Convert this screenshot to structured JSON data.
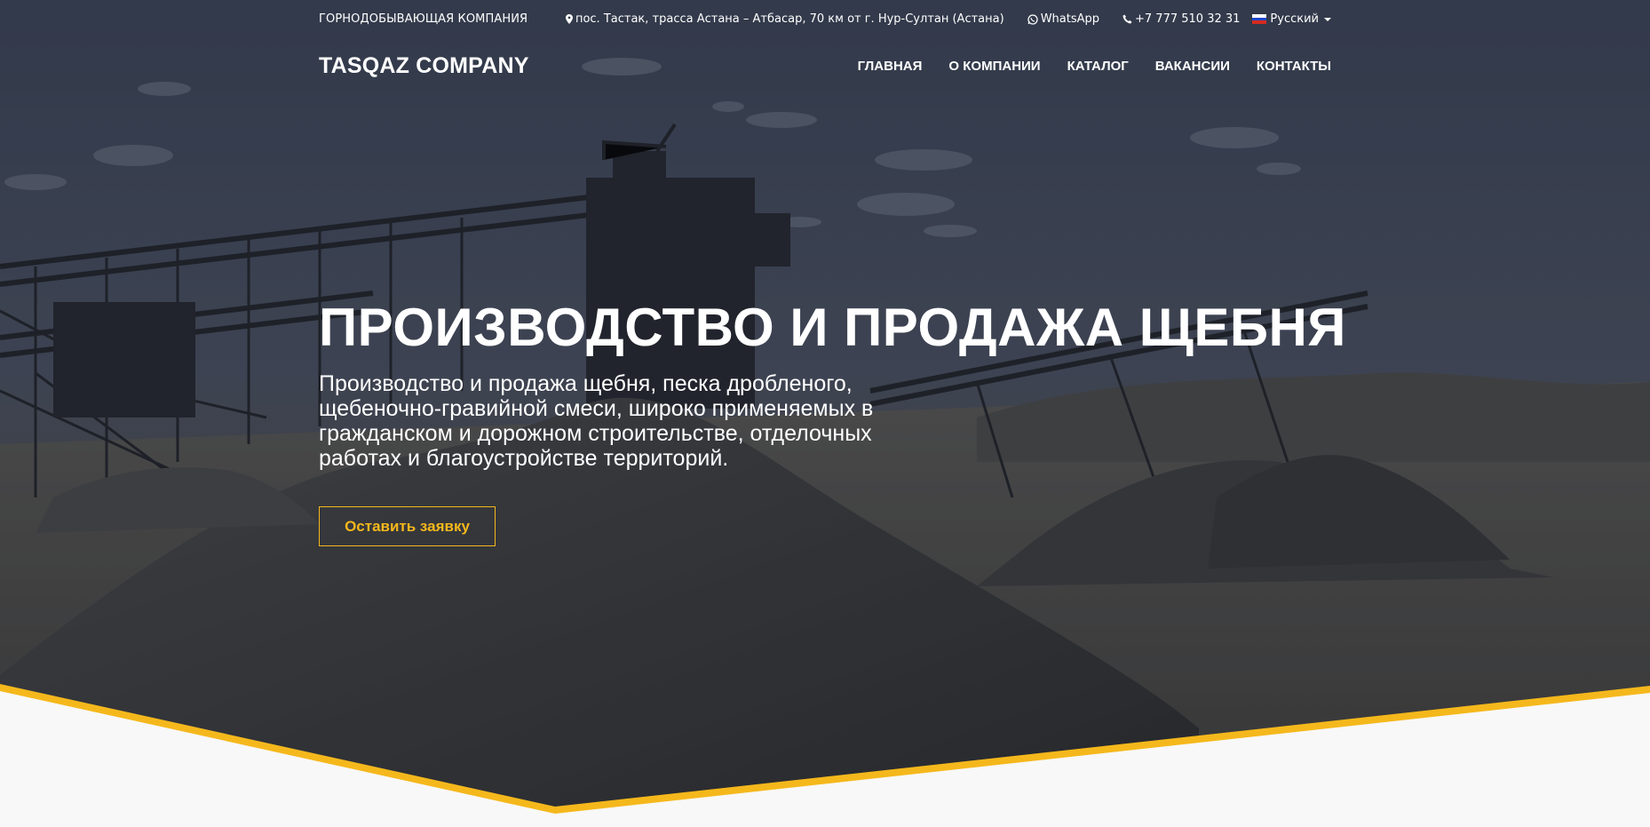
{
  "topbar": {
    "company_type": "ГОРНОДОБЫВАЮЩАЯ КОМПАНИЯ",
    "address": "пос. Тастак, трасса Астана – Атбасар, 70 км от г. Нур-Султан (Астана)",
    "whatsapp": "WhatsApp",
    "phone": "+7 777 510 32 31",
    "language": "Русский"
  },
  "header": {
    "logo": "TASQAZ COMPANY",
    "menu": [
      {
        "label": "ГЛАВНАЯ"
      },
      {
        "label": "О КОМПАНИИ"
      },
      {
        "label": "КАТАЛОГ"
      },
      {
        "label": "ВАКАНСИИ"
      },
      {
        "label": "КОНТАКТЫ"
      }
    ]
  },
  "hero": {
    "title": "ПРОИЗВОДСТВО И ПРОДАЖА ЩЕБНЯ",
    "lead": "Производство и продажа щебня, песка дробленого, щебеночно-гравийной смеси, широко применяемых в гражданском и дорожном строительстве, отделочных работах и благоустройстве территорий.",
    "cta_label": "Оставить заявку"
  },
  "icons": {
    "address": "map-marker-icon",
    "whatsapp": "whatsapp-icon",
    "phone": "phone-icon",
    "language": "russia-flag-icon"
  },
  "colors": {
    "accent": "#f5b81c",
    "overlay": "#2b3140",
    "text": "#ffffff"
  }
}
